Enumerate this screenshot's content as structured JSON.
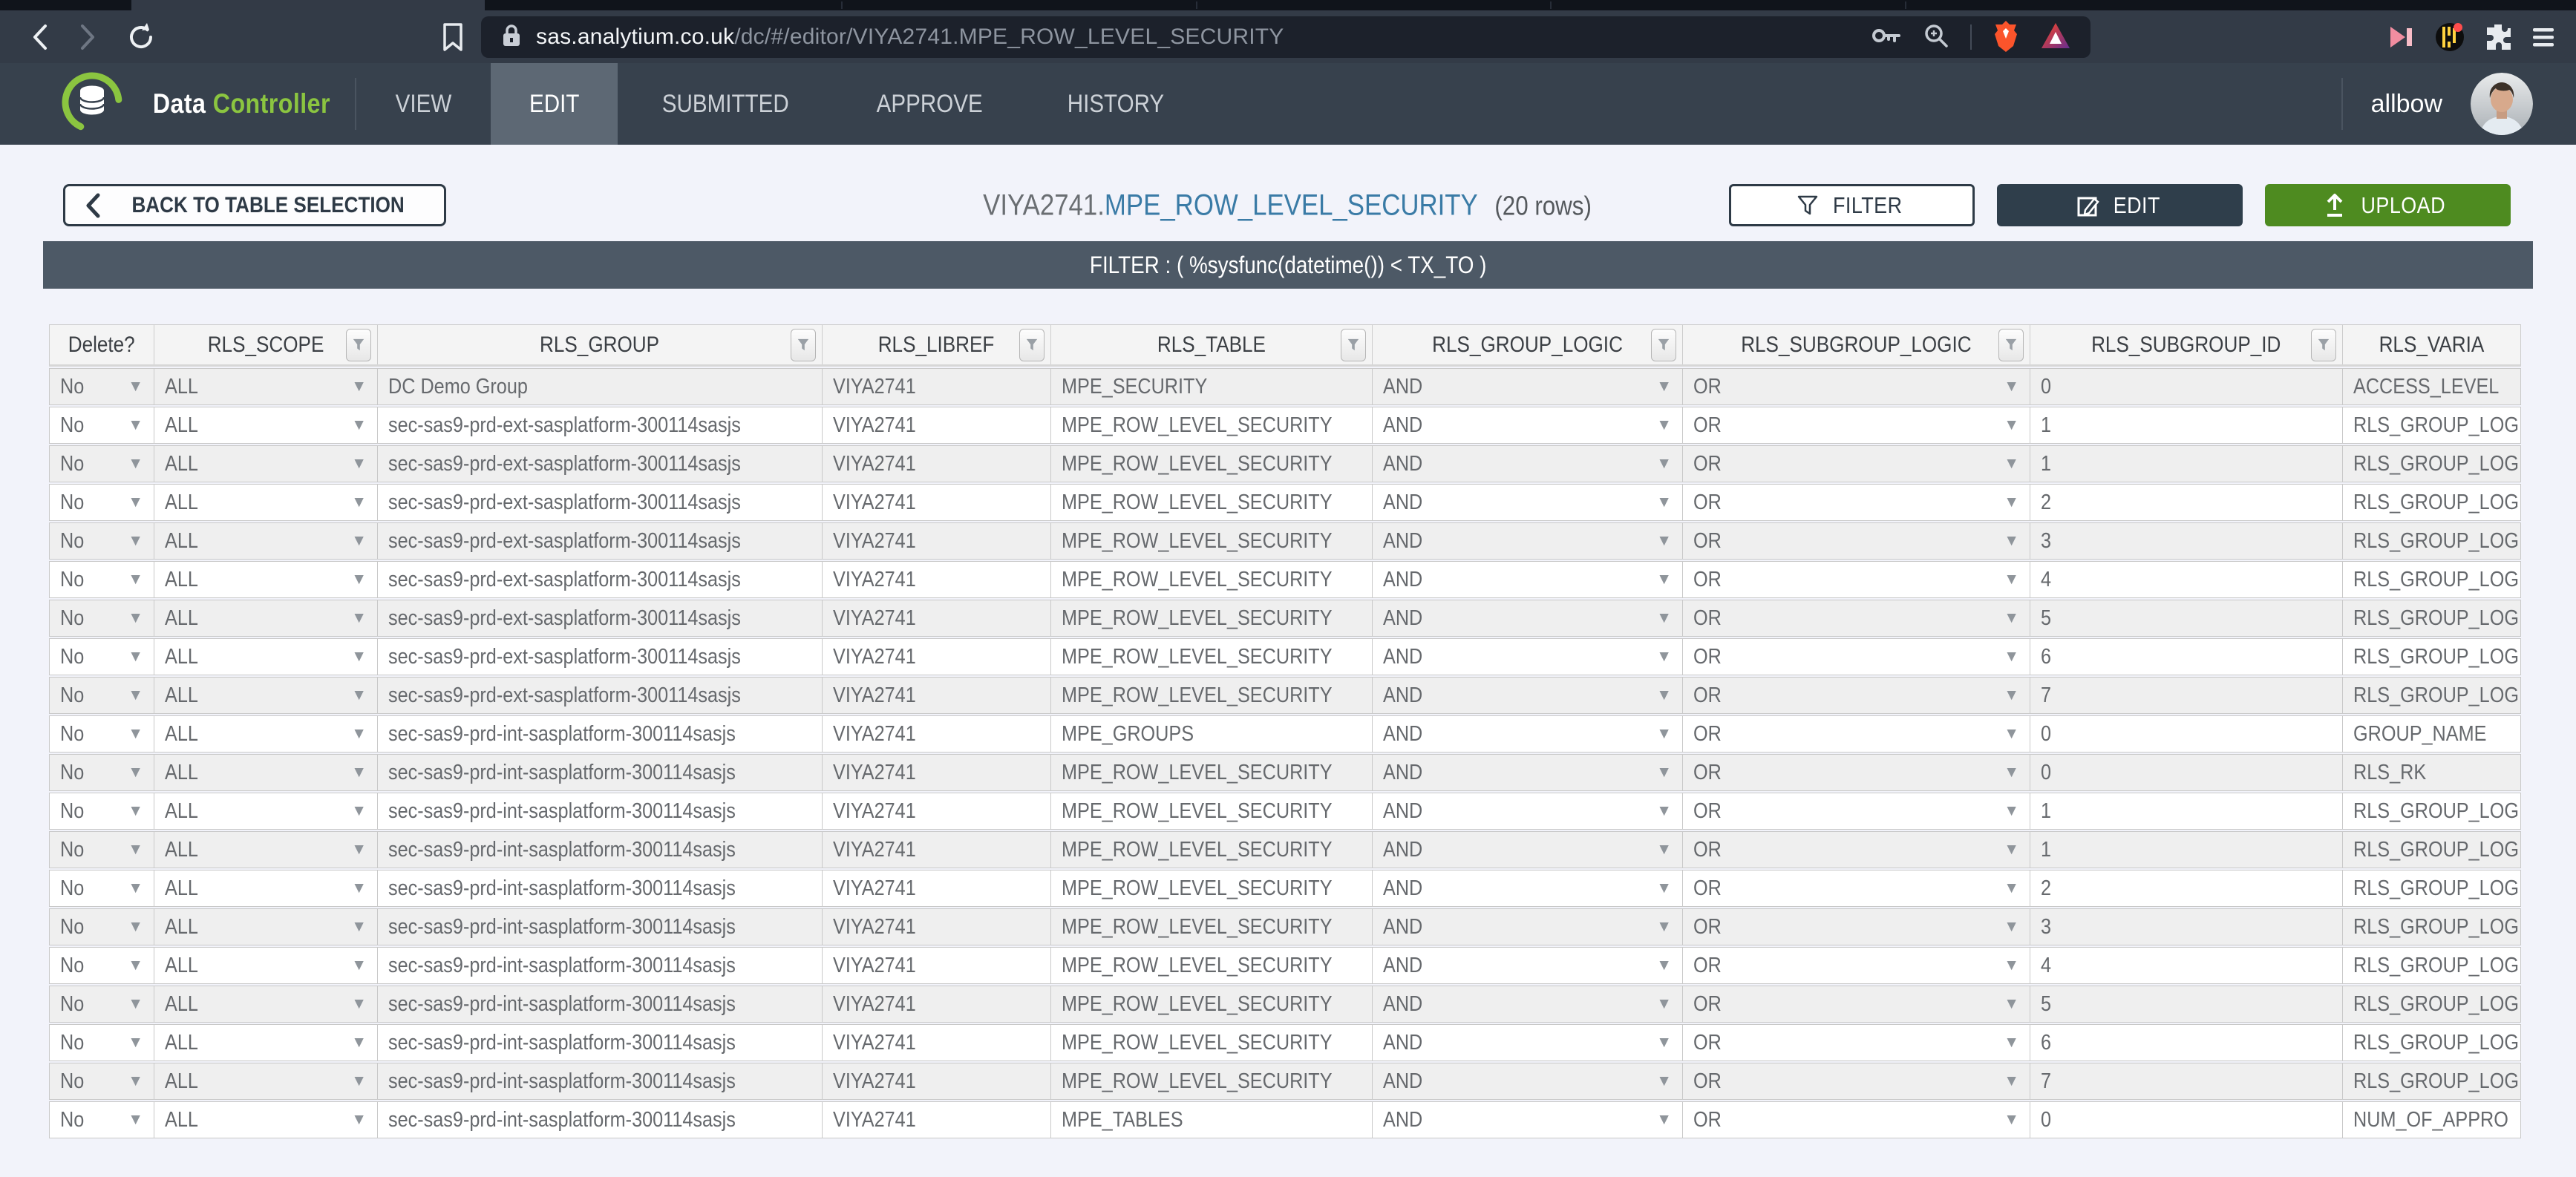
{
  "browser": {
    "url_host": "sas.analytium.co.uk",
    "url_path": "/dc/#/editor/VIYA2741.MPE_ROW_LEVEL_SECURITY"
  },
  "header": {
    "brand_primary": "Data",
    "brand_accent": "Controller",
    "nav": [
      {
        "label": "VIEW",
        "active": false
      },
      {
        "label": "EDIT",
        "active": true
      },
      {
        "label": "SUBMITTED",
        "active": false
      },
      {
        "label": "APPROVE",
        "active": false
      },
      {
        "label": "HISTORY",
        "active": false
      }
    ],
    "username": "allbow"
  },
  "toolbar": {
    "back_button": "BACK TO TABLE SELECTION",
    "title_libref": "VIYA2741.",
    "title_table": "MPE_ROW_LEVEL_SECURITY",
    "row_count": "(20 rows)",
    "filter_button": "FILTER",
    "edit_button": "EDIT",
    "upload_button": "UPLOAD"
  },
  "filter_banner": "FILTER : ( %sysfunc(datetime()) < TX_TO )",
  "icons": {
    "dropdown_arrow": "▼"
  },
  "colors": {
    "brand_green": "#8bc540",
    "upload_green": "#4e8b20",
    "header_dark": "#37414d",
    "active_nav": "#5d6874",
    "title_blue": "#3a7ba6",
    "filter_banner_bg": "#4d5966"
  },
  "table": {
    "columns": [
      {
        "label": "Delete?",
        "has_filter": false,
        "dropdown": true
      },
      {
        "label": "RLS_SCOPE",
        "has_filter": true,
        "dropdown": true
      },
      {
        "label": "RLS_GROUP",
        "has_filter": true,
        "dropdown": false
      },
      {
        "label": "RLS_LIBREF",
        "has_filter": true,
        "dropdown": false
      },
      {
        "label": "RLS_TABLE",
        "has_filter": true,
        "dropdown": false
      },
      {
        "label": "RLS_GROUP_LOGIC",
        "has_filter": true,
        "dropdown": true
      },
      {
        "label": "RLS_SUBGROUP_LOGIC",
        "has_filter": true,
        "dropdown": true
      },
      {
        "label": "RLS_SUBGROUP_ID",
        "has_filter": true,
        "dropdown": false
      },
      {
        "label": "RLS_VARIA",
        "has_filter": false,
        "dropdown": false
      }
    ],
    "rows": [
      [
        "No",
        "ALL",
        "DC Demo Group",
        "VIYA2741",
        "MPE_SECURITY",
        "AND",
        "OR",
        "0",
        "ACCESS_LEVEL"
      ],
      [
        "No",
        "ALL",
        "sec-sas9-prd-ext-sasplatform-300114sasjs",
        "VIYA2741",
        "MPE_ROW_LEVEL_SECURITY",
        "AND",
        "OR",
        "1",
        "RLS_GROUP_LOG"
      ],
      [
        "No",
        "ALL",
        "sec-sas9-prd-ext-sasplatform-300114sasjs",
        "VIYA2741",
        "MPE_ROW_LEVEL_SECURITY",
        "AND",
        "OR",
        "1",
        "RLS_GROUP_LOG"
      ],
      [
        "No",
        "ALL",
        "sec-sas9-prd-ext-sasplatform-300114sasjs",
        "VIYA2741",
        "MPE_ROW_LEVEL_SECURITY",
        "AND",
        "OR",
        "2",
        "RLS_GROUP_LOG"
      ],
      [
        "No",
        "ALL",
        "sec-sas9-prd-ext-sasplatform-300114sasjs",
        "VIYA2741",
        "MPE_ROW_LEVEL_SECURITY",
        "AND",
        "OR",
        "3",
        "RLS_GROUP_LOG"
      ],
      [
        "No",
        "ALL",
        "sec-sas9-prd-ext-sasplatform-300114sasjs",
        "VIYA2741",
        "MPE_ROW_LEVEL_SECURITY",
        "AND",
        "OR",
        "4",
        "RLS_GROUP_LOG"
      ],
      [
        "No",
        "ALL",
        "sec-sas9-prd-ext-sasplatform-300114sasjs",
        "VIYA2741",
        "MPE_ROW_LEVEL_SECURITY",
        "AND",
        "OR",
        "5",
        "RLS_GROUP_LOG"
      ],
      [
        "No",
        "ALL",
        "sec-sas9-prd-ext-sasplatform-300114sasjs",
        "VIYA2741",
        "MPE_ROW_LEVEL_SECURITY",
        "AND",
        "OR",
        "6",
        "RLS_GROUP_LOG"
      ],
      [
        "No",
        "ALL",
        "sec-sas9-prd-ext-sasplatform-300114sasjs",
        "VIYA2741",
        "MPE_ROW_LEVEL_SECURITY",
        "AND",
        "OR",
        "7",
        "RLS_GROUP_LOG"
      ],
      [
        "No",
        "ALL",
        "sec-sas9-prd-int-sasplatform-300114sasjs",
        "VIYA2741",
        "MPE_GROUPS",
        "AND",
        "OR",
        "0",
        "GROUP_NAME"
      ],
      [
        "No",
        "ALL",
        "sec-sas9-prd-int-sasplatform-300114sasjs",
        "VIYA2741",
        "MPE_ROW_LEVEL_SECURITY",
        "AND",
        "OR",
        "0",
        "RLS_RK"
      ],
      [
        "No",
        "ALL",
        "sec-sas9-prd-int-sasplatform-300114sasjs",
        "VIYA2741",
        "MPE_ROW_LEVEL_SECURITY",
        "AND",
        "OR",
        "1",
        "RLS_GROUP_LOG"
      ],
      [
        "No",
        "ALL",
        "sec-sas9-prd-int-sasplatform-300114sasjs",
        "VIYA2741",
        "MPE_ROW_LEVEL_SECURITY",
        "AND",
        "OR",
        "1",
        "RLS_GROUP_LOG"
      ],
      [
        "No",
        "ALL",
        "sec-sas9-prd-int-sasplatform-300114sasjs",
        "VIYA2741",
        "MPE_ROW_LEVEL_SECURITY",
        "AND",
        "OR",
        "2",
        "RLS_GROUP_LOG"
      ],
      [
        "No",
        "ALL",
        "sec-sas9-prd-int-sasplatform-300114sasjs",
        "VIYA2741",
        "MPE_ROW_LEVEL_SECURITY",
        "AND",
        "OR",
        "3",
        "RLS_GROUP_LOG"
      ],
      [
        "No",
        "ALL",
        "sec-sas9-prd-int-sasplatform-300114sasjs",
        "VIYA2741",
        "MPE_ROW_LEVEL_SECURITY",
        "AND",
        "OR",
        "4",
        "RLS_GROUP_LOG"
      ],
      [
        "No",
        "ALL",
        "sec-sas9-prd-int-sasplatform-300114sasjs",
        "VIYA2741",
        "MPE_ROW_LEVEL_SECURITY",
        "AND",
        "OR",
        "5",
        "RLS_GROUP_LOG"
      ],
      [
        "No",
        "ALL",
        "sec-sas9-prd-int-sasplatform-300114sasjs",
        "VIYA2741",
        "MPE_ROW_LEVEL_SECURITY",
        "AND",
        "OR",
        "6",
        "RLS_GROUP_LOG"
      ],
      [
        "No",
        "ALL",
        "sec-sas9-prd-int-sasplatform-300114sasjs",
        "VIYA2741",
        "MPE_ROW_LEVEL_SECURITY",
        "AND",
        "OR",
        "7",
        "RLS_GROUP_LOG"
      ],
      [
        "No",
        "ALL",
        "sec-sas9-prd-int-sasplatform-300114sasjs",
        "VIYA2741",
        "MPE_TABLES",
        "AND",
        "OR",
        "0",
        "NUM_OF_APPRO"
      ]
    ]
  }
}
